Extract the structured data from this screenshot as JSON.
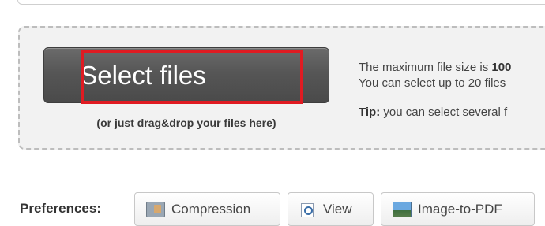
{
  "upload": {
    "select_label": "Select files",
    "drag_hint": "(or just drag&drop your files here)",
    "info_line1_prefix": "The maximum file size is ",
    "info_line1_bold": "100",
    "info_line2": "You can select up to 20 files",
    "tip_label": "Tip:",
    "tip_text": " you can select several f"
  },
  "preferences": {
    "label": "Preferences:",
    "buttons": [
      {
        "label": "Compression",
        "icon": "compression-icon"
      },
      {
        "label": "View",
        "icon": "view-icon"
      },
      {
        "label": "Image-to-PDF",
        "icon": "image-icon"
      }
    ]
  },
  "colors": {
    "highlight": "#e01b22",
    "button_dark": "#565656"
  }
}
